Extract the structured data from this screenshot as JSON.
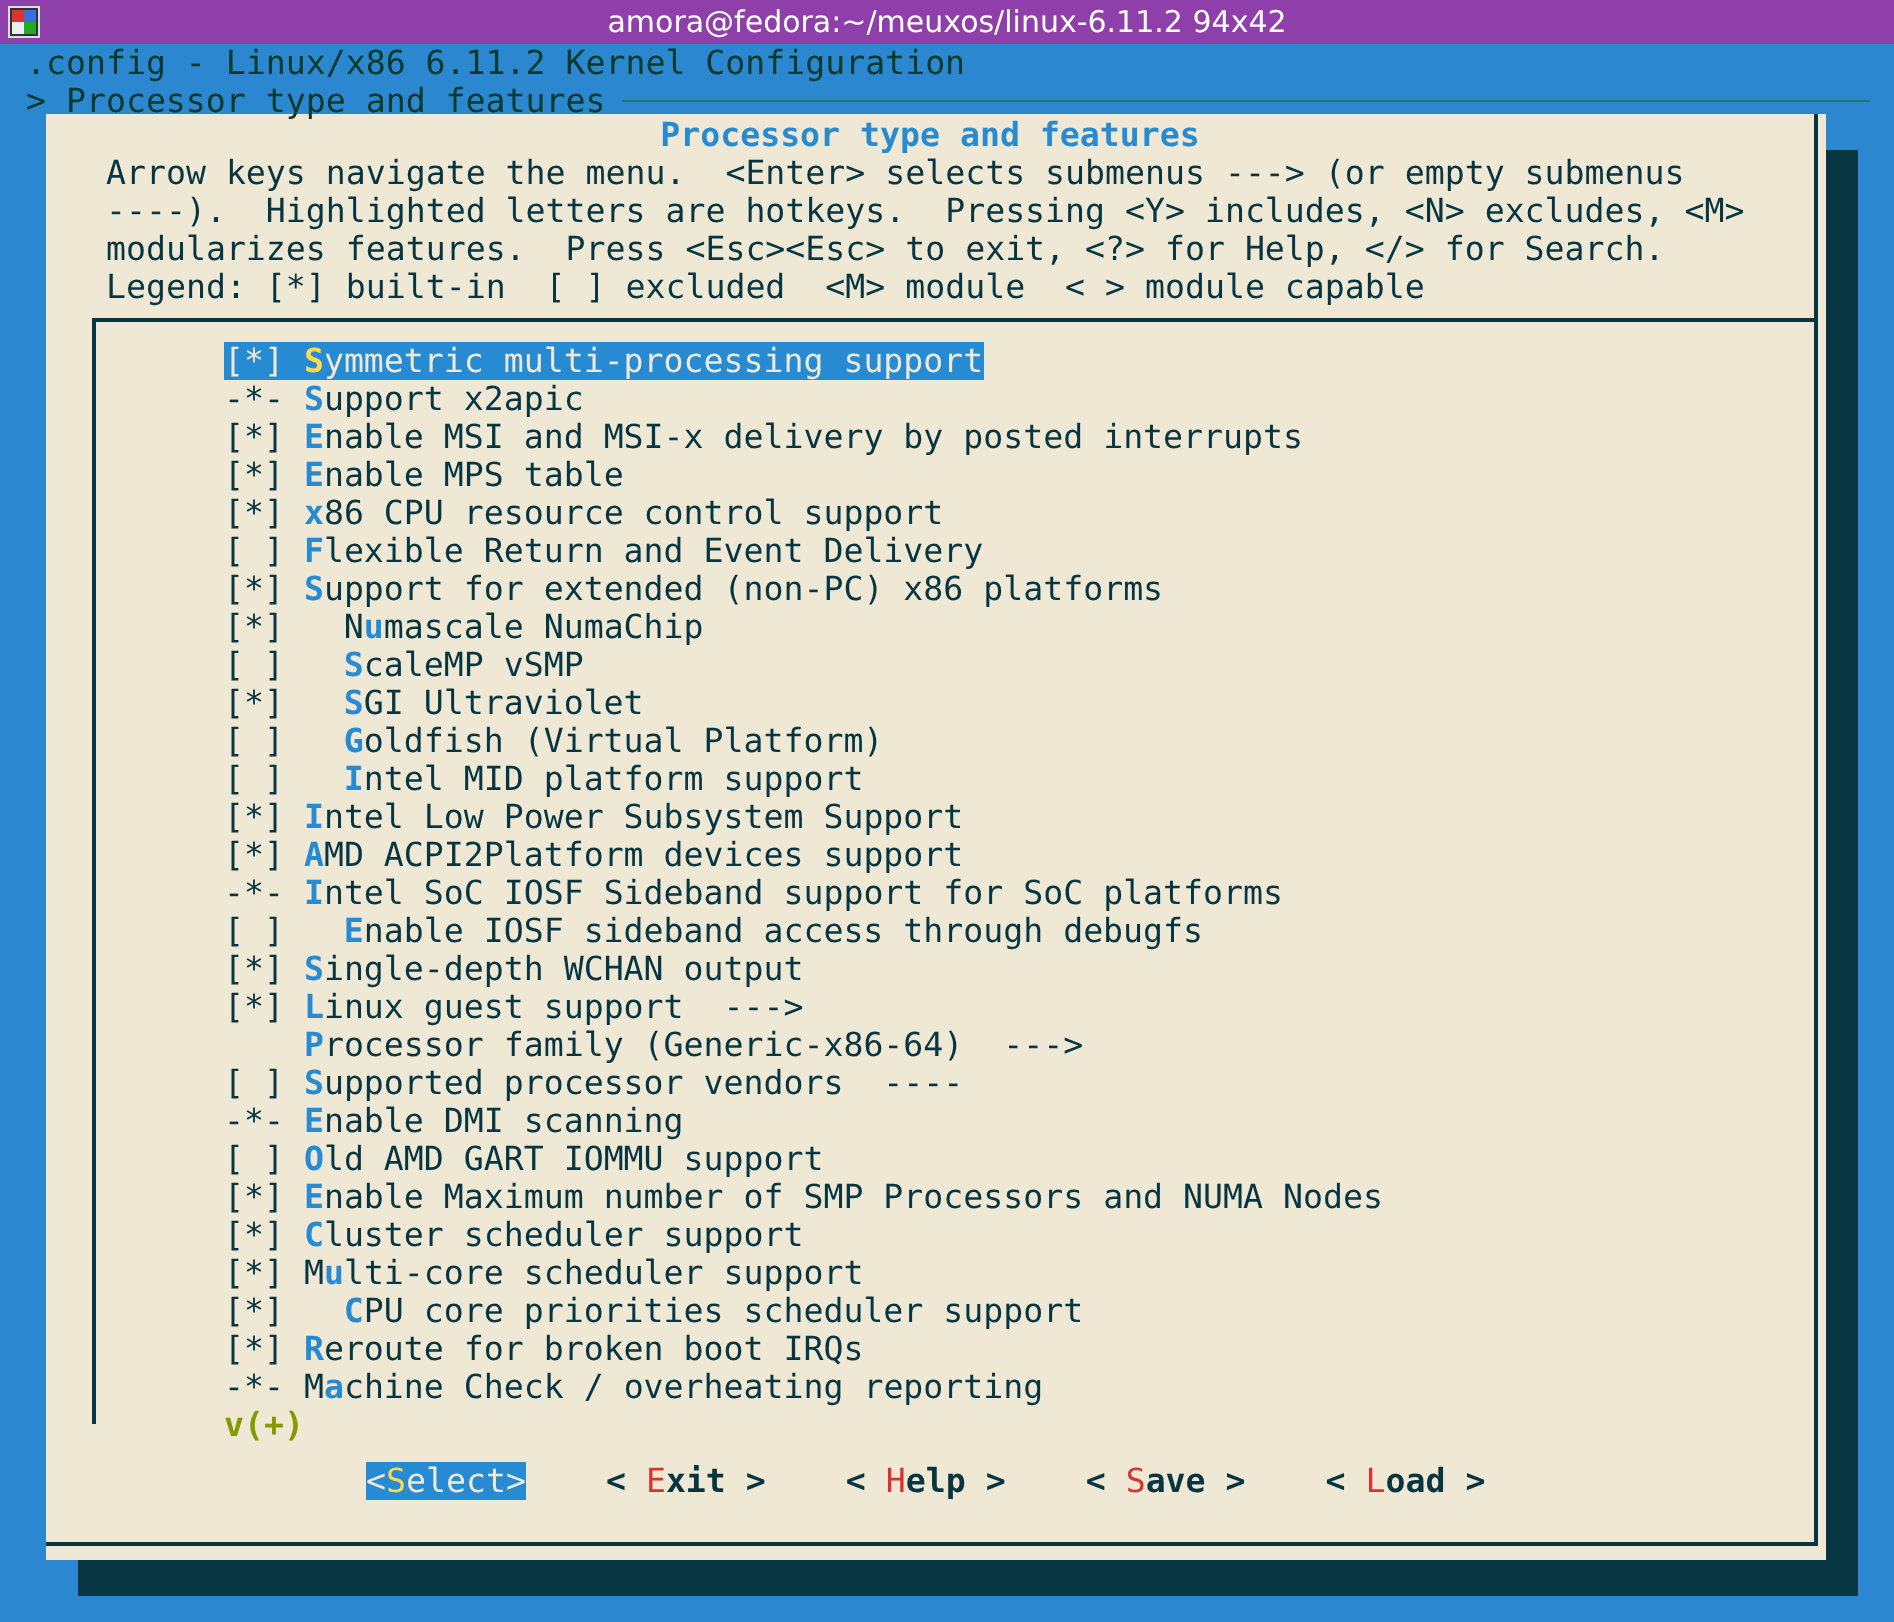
{
  "window": {
    "title": "amora@fedora:~/meuxos/linux-6.11.2 94x42"
  },
  "header": {
    "config_title": ".config - Linux/x86 6.11.2 Kernel Configuration",
    "breadcrumb": "> Processor type and features"
  },
  "dialog": {
    "title": "Processor type and features",
    "help_lines": [
      "Arrow keys navigate the menu.  <Enter> selects submenus ---> (or empty submenus",
      "----).  Highlighted letters are hotkeys.  Pressing <Y> includes, <N> excludes, <M>",
      "modularizes features.  Press <Esc><Esc> to exit, <?> for Help, </> for Search.",
      "Legend: [*] built-in  [ ] excluded  <M> module  < > module capable"
    ]
  },
  "menu": {
    "items": [
      {
        "prefix": "[*]",
        "label": "**S**ymmetric multi-processing support",
        "selected": true
      },
      {
        "prefix": "-*-",
        "label": "**S**upport x2apic",
        "selected": false
      },
      {
        "prefix": "[*]",
        "label": "**E**nable MSI and MSI-x delivery by posted interrupts",
        "selected": false
      },
      {
        "prefix": "[*]",
        "label": "**E**nable MPS table",
        "selected": false
      },
      {
        "prefix": "[*]",
        "label": "**x**86 CPU resource control support",
        "selected": false
      },
      {
        "prefix": "[ ]",
        "label": "**F**lexible Return and Event Delivery",
        "selected": false
      },
      {
        "prefix": "[*]",
        "label": "**S**upport for extended (non-PC) x86 platforms",
        "selected": false,
        "children": [
          {
            "prefix": "[*]",
            "label": "N**u**mascale NumaChip",
            "selected": false
          },
          {
            "prefix": "[ ]",
            "label": "**S**caleMP vSMP",
            "selected": false
          },
          {
            "prefix": "[*]",
            "label": "**S**GI Ultraviolet",
            "selected": false
          },
          {
            "prefix": "[ ]",
            "label": "**G**oldfish (Virtual Platform)",
            "selected": false
          },
          {
            "prefix": "[ ]",
            "label": "**I**ntel MID platform support",
            "selected": false
          }
        ]
      },
      {
        "prefix": "[*]",
        "label": "**I**ntel Low Power Subsystem Support",
        "selected": false
      },
      {
        "prefix": "[*]",
        "label": "**A**MD ACPI2Platform devices support",
        "selected": false
      },
      {
        "prefix": "-*-",
        "label": "**I**ntel SoC IOSF Sideband support for SoC platforms",
        "selected": false,
        "children": [
          {
            "prefix": "[ ]",
            "label": "**E**nable IOSF sideband access through debugfs",
            "selected": false
          }
        ]
      },
      {
        "prefix": "[*]",
        "label": "**S**ingle-depth WCHAN output",
        "selected": false
      },
      {
        "prefix": "[*]",
        "label": "**L**inux guest support  --->",
        "selected": false
      },
      {
        "label": "**P**rocessor family (Generic-x86-64)  --->",
        "selected": false
      },
      {
        "prefix": "[ ]",
        "label": "**S**upported processor vendors  ----",
        "selected": false
      },
      {
        "prefix": "-*-",
        "label": "**E**nable DMI scanning",
        "selected": false
      },
      {
        "prefix": "[ ]",
        "label": "**O**ld AMD GART IOMMU support",
        "selected": false
      },
      {
        "prefix": "[*]",
        "label": "**E**nable Maximum number of SMP Processors and NUMA Nodes",
        "selected": false
      },
      {
        "prefix": "[*]",
        "label": "**C**luster scheduler support",
        "selected": false
      },
      {
        "prefix": "[*]",
        "label": "M**u**lti-core scheduler support",
        "selected": false,
        "children": [
          {
            "prefix": "[*]",
            "label": "**C**PU core priorities scheduler support",
            "selected": false
          }
        ]
      },
      {
        "prefix": "[*]",
        "label": "**R**eroute for broken boot IRQs",
        "selected": false
      },
      {
        "prefix": "-*-",
        "label": "M**a**chine Check / overheating reporting",
        "selected": false
      }
    ],
    "more_indicator": "v(+)"
  },
  "buttons": [
    {
      "label": "<**S**elect>",
      "selected": true
    },
    {
      "label": "< **E**xit >",
      "selected": false
    },
    {
      "label": "< **H**elp >",
      "selected": false
    },
    {
      "label": "< **S**ave >",
      "selected": false
    },
    {
      "label": "< **L**oad >",
      "selected": false
    }
  ]
}
